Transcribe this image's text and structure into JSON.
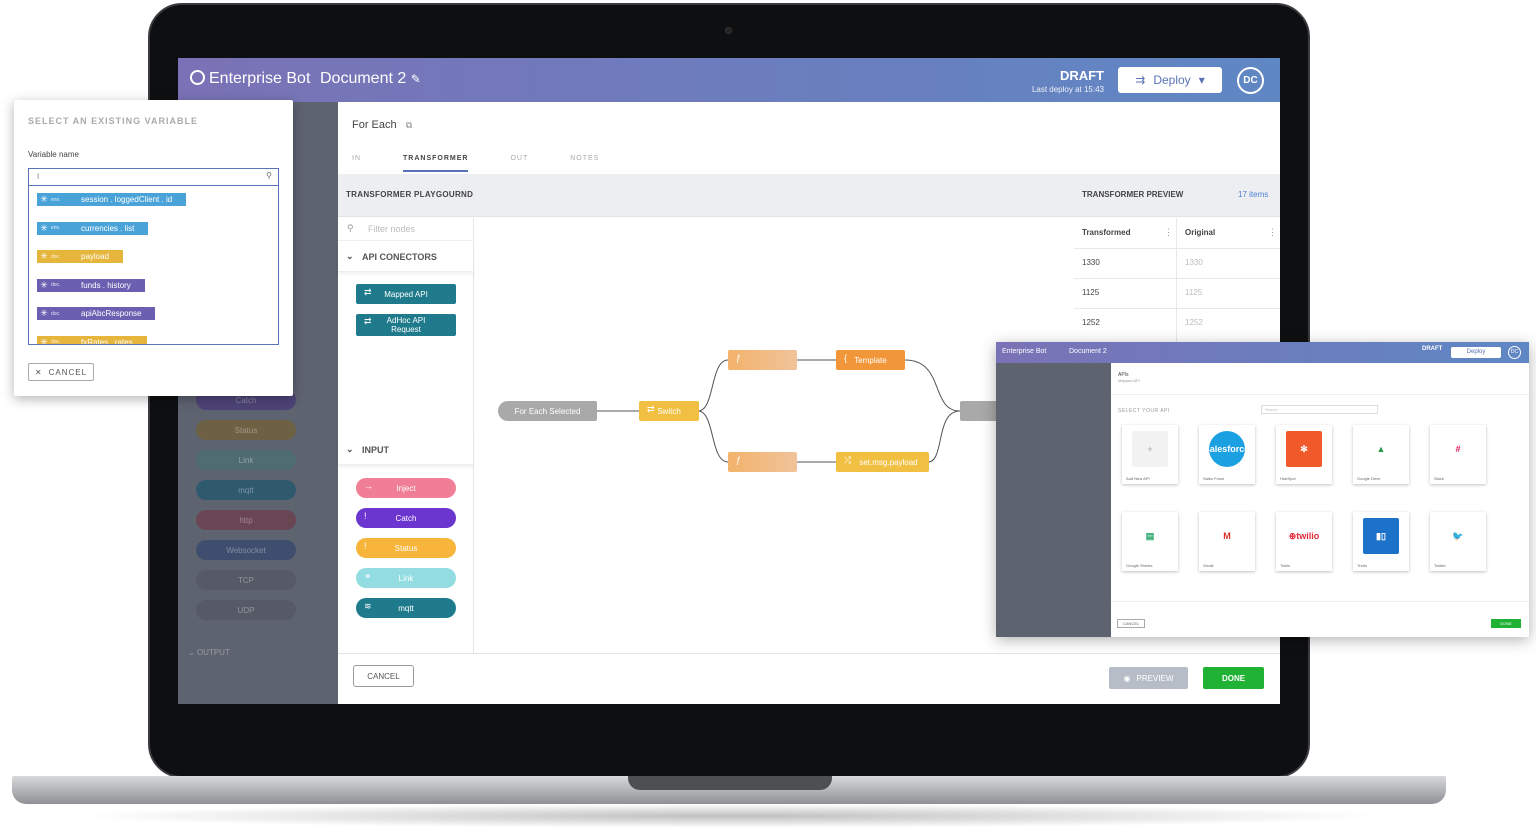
{
  "header": {
    "brand": "Enterprise Bot",
    "document": "Document 2",
    "status": "DRAFT",
    "last_deploy": "Last deploy at 15:43",
    "deploy_label": "Deploy",
    "avatar": "DC"
  },
  "panel": {
    "title": "For Each",
    "tabs": [
      "IN",
      "TRANSFORMER",
      "OUT",
      "NOTES"
    ],
    "playground_title": "TRANSFORMER PLAYGOURND",
    "preview_title": "TRANSFORMER PREVIEW",
    "items_count": "17 items",
    "filter_placeholder": "Filter nodes"
  },
  "palette": {
    "api_category": "API CONECTORS",
    "api_nodes": [
      "Mapped API",
      "AdHoc API Request"
    ],
    "input_category": "INPUT",
    "input_nodes": [
      "Inject",
      "Catch",
      "Status",
      "Link",
      "mqtt"
    ]
  },
  "left_dim": {
    "nodes": [
      "Catch",
      "Status",
      "Link",
      "mqtt",
      "http",
      "Websocket",
      "TCP",
      "UDP"
    ],
    "output_category": "OUTPUT"
  },
  "flow": {
    "nodes": [
      "For Each Selected",
      "Switch",
      "",
      "Template",
      "",
      "set.msg.payload"
    ]
  },
  "preview_table": {
    "columns": [
      "Transformed",
      "Original"
    ],
    "rows": [
      [
        "1330",
        "1330"
      ],
      [
        "1125",
        "1125"
      ],
      [
        "1252",
        "1252"
      ]
    ]
  },
  "footer": {
    "cancel": "CANCEL",
    "preview": "PREVIEW",
    "done": "DONE"
  },
  "variable_popup": {
    "title": "SELECT AN EXISTING VARIABLE",
    "label": "Variable name",
    "input_value": "I",
    "items": [
      {
        "type": "env.",
        "name": "session . loggedClient . id",
        "color": "#4aa3d8"
      },
      {
        "type": "env.",
        "name": "currencies . list",
        "color": "#4aa3d8"
      },
      {
        "type": "doc.",
        "name": "payload",
        "color": "#e5b53c"
      },
      {
        "type": "doc.",
        "name": "funds . history",
        "color": "#6a5fb0"
      },
      {
        "type": "doc.",
        "name": "apiAbcResponse",
        "color": "#6a5fb0"
      },
      {
        "type": "doc.",
        "name": "fxRates . rates",
        "color": "#e5b53c"
      }
    ],
    "cancel": "CANCEL"
  },
  "api_window": {
    "brand": "Enterprise Bot",
    "document": "Document 2",
    "status": "DRAFT",
    "deploy": "Deploy",
    "avatar": "DC",
    "section": "APIs",
    "subtitle": "Mapped API",
    "select_label": "SELECT YOUR API",
    "search_placeholder": "Search",
    "cards": [
      "Add New API",
      "Sales Force",
      "HubSpot",
      "Google Drive",
      "Slack",
      "Google Sheets",
      "Gmail",
      "Twilio",
      "Trello",
      "Twitter"
    ],
    "cancel": "CANCEL",
    "done": "DONE"
  }
}
